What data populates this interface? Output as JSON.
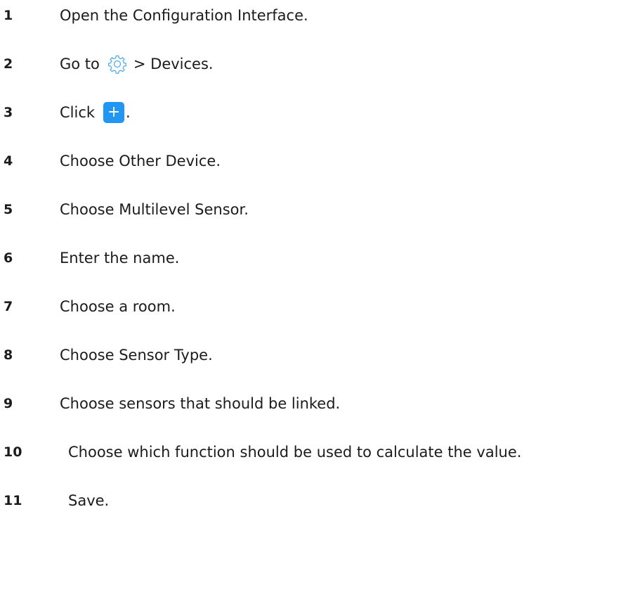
{
  "steps": [
    {
      "num": "1",
      "text": "Open the Configuration Interface."
    },
    {
      "num": "2",
      "before": "Go to",
      "icon": "gear-icon",
      "after": "> Devices."
    },
    {
      "num": "3",
      "before": "Click",
      "icon": "plus-icon",
      "icon_label": "+",
      "after": "."
    },
    {
      "num": "4",
      "text": "Choose Other Device."
    },
    {
      "num": "5",
      "text": "Choose Multilevel Sensor."
    },
    {
      "num": "6",
      "text": "Enter the name."
    },
    {
      "num": "7",
      "text": "Choose a room."
    },
    {
      "num": "8",
      "text": "Choose Sensor Type."
    },
    {
      "num": "9",
      "text": "Choose sensors that should be linked."
    },
    {
      "num": "10",
      "text": "Choose which function should be used to calculate the value."
    },
    {
      "num": "11",
      "text": "Save."
    }
  ],
  "colors": {
    "text": "#1b1b1b",
    "gear_icon": "#4aa8f0",
    "plus_button": "#2196f3"
  }
}
